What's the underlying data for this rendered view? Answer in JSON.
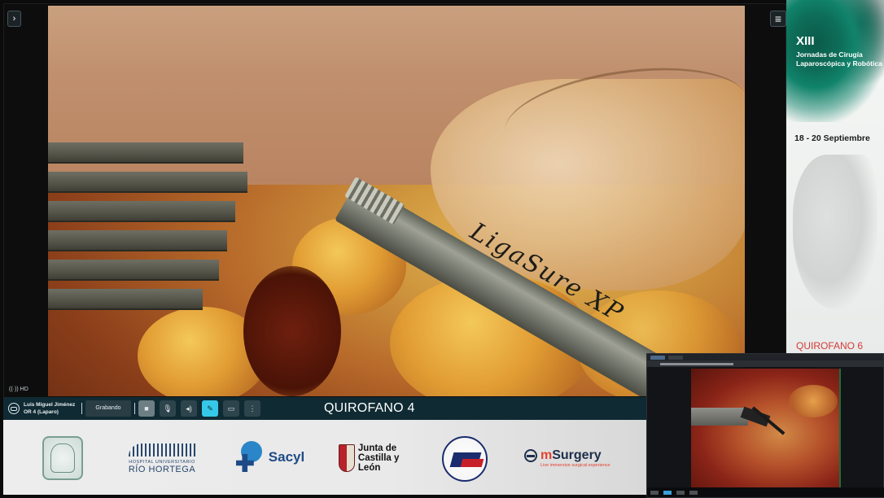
{
  "colors": {
    "control_bar_bg": "#0f2a33",
    "accent": "#36c8e8",
    "quirofano6_text": "#d43a3a",
    "msurgery_accent": "#e4412e"
  },
  "main": {
    "hd_label": "HD",
    "video": {
      "instrument_text": "LigaSure XP"
    }
  },
  "control_bar": {
    "user_name": "Luis Miguel Jiménez",
    "user_location": "OR 4 (Laparo)",
    "recording_label": "Grabando",
    "room_title": "QUIROFANO 4",
    "icons": [
      "camera-icon",
      "microphone-icon",
      "speaker-icon",
      "pen-icon",
      "screen-share-icon",
      "more-vertical-icon"
    ]
  },
  "sponsors": {
    "hospital_small": "HOSPITAL UNIVERSITARIO",
    "hospital_big": "RÍO HORTEGA",
    "sacyl": "Sacyl",
    "jcyl_line1": "Junta de",
    "jcyl_line2": "Castilla y León",
    "msurgery_m": "m",
    "msurgery_rest": "Surgery",
    "msurgery_tagline": "Live immersive surgical experience"
  },
  "poster": {
    "edition": "XIII",
    "title": "Jornadas de Cirugía Laparoscópica y Robótica",
    "dates": "18 - 20 Septiembre",
    "room": "QUIROFANO 6"
  }
}
